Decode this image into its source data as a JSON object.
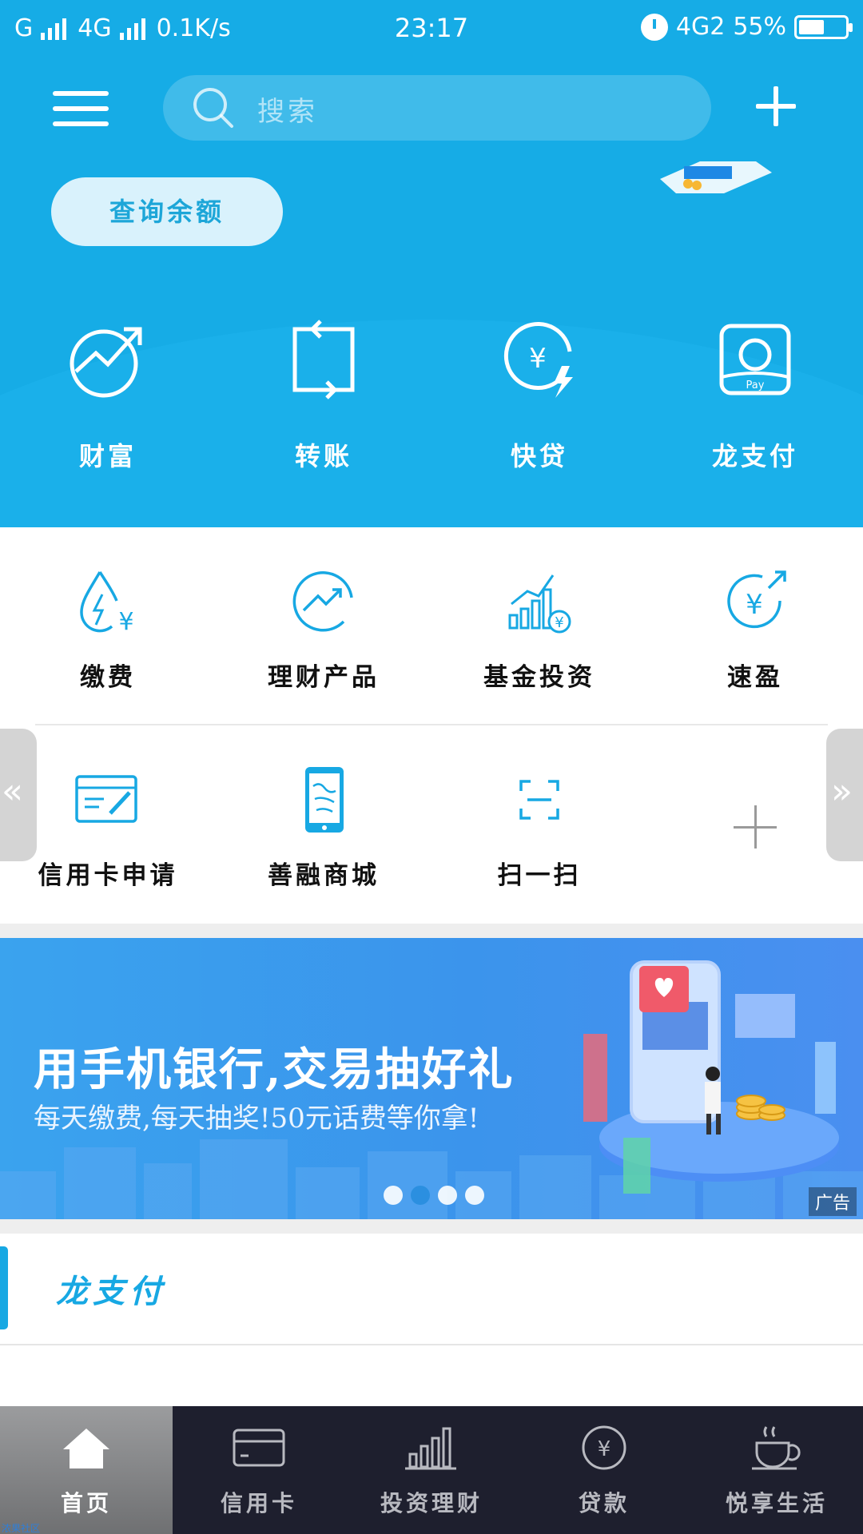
{
  "status_bar": {
    "carrier1": "G",
    "network": "4G",
    "speed": "0.1K/s",
    "time": "23:17",
    "network2": "4G2",
    "battery_pct": "55%",
    "battery_level": 0.55
  },
  "header": {
    "search_placeholder": "搜索",
    "balance_button": "查询余额"
  },
  "top_functions": [
    {
      "label": "财富",
      "icon": "growth-arrow-icon"
    },
    {
      "label": "转账",
      "icon": "transfer-icon"
    },
    {
      "label": "快贷",
      "icon": "quick-loan-icon"
    },
    {
      "label": "龙支付",
      "icon": "pay-icon"
    }
  ],
  "grid_row1": [
    {
      "label": "缴费",
      "icon": "water-drop-yen-icon"
    },
    {
      "label": "理财产品",
      "icon": "trend-circle-icon"
    },
    {
      "label": "基金投资",
      "icon": "bar-chart-yen-icon"
    },
    {
      "label": "速盈",
      "icon": "yen-circle-arrow-icon"
    }
  ],
  "grid_row2": [
    {
      "label": "信用卡申请",
      "icon": "card-pen-icon"
    },
    {
      "label": "善融商城",
      "icon": "phone-mall-icon"
    },
    {
      "label": "扫一扫",
      "icon": "scan-icon"
    }
  ],
  "banner": {
    "title": "用手机银行,交易抽好礼",
    "subtitle": "每天缴费,每天抽奖!50元话费等你拿!",
    "ad_label": "广告",
    "slides": 4,
    "active_slide": 2
  },
  "section": {
    "title": "龙支付"
  },
  "tabbar": [
    {
      "label": "首页",
      "icon": "home-icon",
      "active": true
    },
    {
      "label": "信用卡",
      "icon": "credit-card-icon",
      "active": false
    },
    {
      "label": "投资理财",
      "icon": "bar-chart-icon",
      "active": false
    },
    {
      "label": "贷款",
      "icon": "yen-coin-icon",
      "active": false
    },
    {
      "label": "悦享生活",
      "icon": "coffee-cup-icon",
      "active": false
    }
  ],
  "watermark": "浓果社区",
  "colors": {
    "header_blue": "#16ace6",
    "accent": "#17a8e3",
    "tabbar_bg": "#1e1f2e"
  }
}
